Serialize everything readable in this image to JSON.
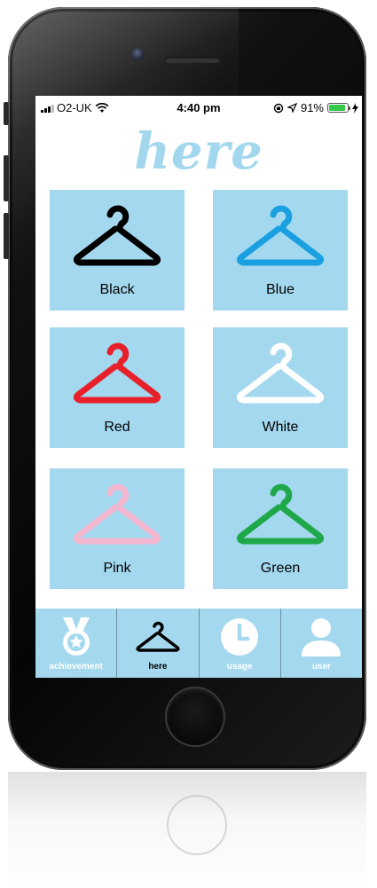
{
  "status_bar": {
    "carrier": "O2-UK",
    "time": "4:40 pm",
    "battery": "91%",
    "battery_level": 0.91
  },
  "app": {
    "title": "here"
  },
  "colors": {
    "tile_background": "#a3d8ef",
    "title_color": "#a2d7ee"
  },
  "hangers": [
    {
      "label": "Black",
      "color": "#000000"
    },
    {
      "label": "Blue",
      "color": "#1aa0e0"
    },
    {
      "label": "Red",
      "color": "#e8202a"
    },
    {
      "label": "White",
      "color": "#ffffff"
    },
    {
      "label": "Pink",
      "color": "#f2b6cf"
    },
    {
      "label": "Green",
      "color": "#1fa84a"
    }
  ],
  "tabbar": {
    "tabs": [
      {
        "label": "achievement",
        "icon": "medal-icon",
        "active": false
      },
      {
        "label": "here",
        "icon": "hanger-icon",
        "active": true
      },
      {
        "label": "usage",
        "icon": "clock-icon",
        "active": false
      },
      {
        "label": "user",
        "icon": "user-icon",
        "active": false
      }
    ]
  }
}
